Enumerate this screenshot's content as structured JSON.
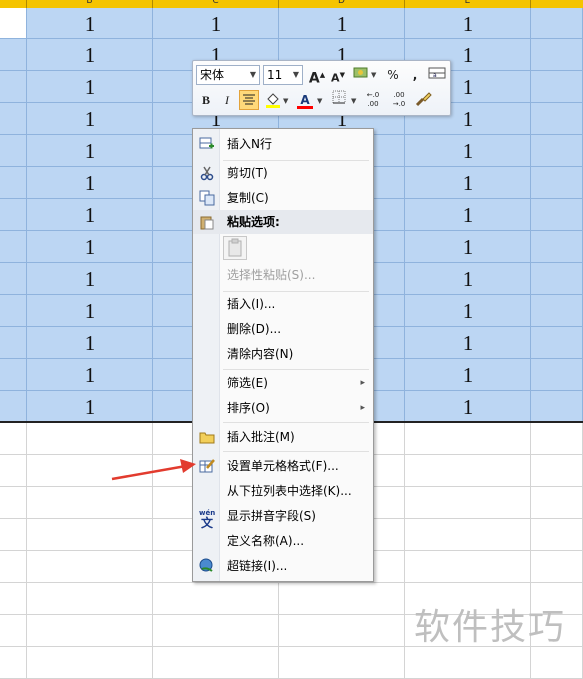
{
  "sheet": {
    "column_headers": [
      "B",
      "C",
      "D",
      "E"
    ],
    "cell_value": "1"
  },
  "mini_toolbar": {
    "font_name": "宋体",
    "font_size": "11",
    "grow_font": "A",
    "shrink_font": "A",
    "percent": "%",
    "comma": ",",
    "bold": "B",
    "italic": "I",
    "font_color": "A",
    "increase_decimal": "←.0 .00",
    "decrease_decimal": ".00 →.0",
    "highlight_color": "#ffff00",
    "font_color_value": "#ff0000"
  },
  "context_menu": {
    "items": [
      {
        "label": "插入N行",
        "icon": "insert-rows-icon"
      },
      {
        "label": "剪切(T)",
        "icon": "scissors-icon"
      },
      {
        "label": "复制(C)",
        "icon": "copy-icon"
      },
      {
        "label": "粘贴选项:",
        "icon": "paste-icon"
      },
      {
        "label": "选择性粘贴(S)...",
        "icon": ""
      },
      {
        "label": "插入(I)...",
        "icon": ""
      },
      {
        "label": "删除(D)...",
        "icon": ""
      },
      {
        "label": "清除内容(N)",
        "icon": ""
      },
      {
        "label": "筛选(E)",
        "icon": ""
      },
      {
        "label": "排序(O)",
        "icon": ""
      },
      {
        "label": "插入批注(M)",
        "icon": "comment-folder-icon"
      },
      {
        "label": "设置单元格格式(F)...",
        "icon": "format-cells-icon"
      },
      {
        "label": "从下拉列表中选择(K)...",
        "icon": ""
      },
      {
        "label": "显示拼音字段(S)",
        "icon": "phonetic-icon"
      },
      {
        "label": "定义名称(A)...",
        "icon": ""
      },
      {
        "label": "超链接(I)...",
        "icon": "hyperlink-icon"
      }
    ],
    "submenu_arrow": "▸"
  },
  "watermark": "软件技巧",
  "colors": {
    "selection": "#bcd6f3",
    "header": "#f5c400",
    "arrow": "#e23b2e"
  }
}
